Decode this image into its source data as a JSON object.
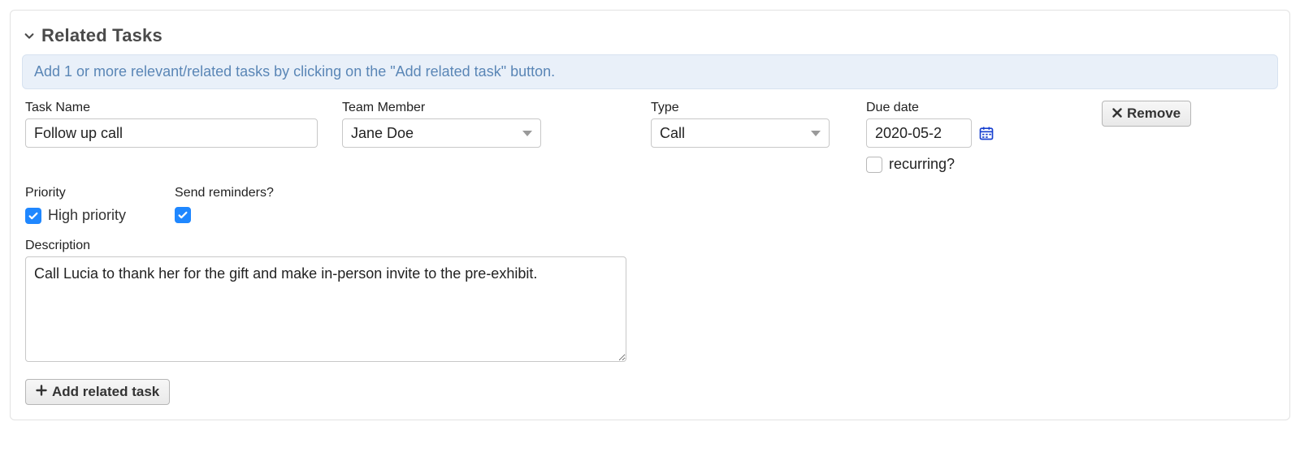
{
  "section": {
    "title": "Related Tasks",
    "expanded": true
  },
  "hint": "Add 1 or more relevant/related tasks by clicking on the \"Add related task\" button.",
  "labels": {
    "task_name": "Task Name",
    "team_member": "Team Member",
    "type": "Type",
    "due_date": "Due date",
    "recurring": "recurring?",
    "priority": "Priority",
    "high_priority": "High priority",
    "send_reminders": "Send reminders?",
    "description": "Description",
    "add_related_task": "Add related task",
    "remove": "Remove"
  },
  "task": {
    "name": "Follow up call",
    "team_member": "Jane Doe",
    "type": "Call",
    "due_date": "2020-05-2",
    "recurring": false,
    "high_priority": true,
    "send_reminders": true,
    "description": "Call Lucia to thank her for the gift and make in-person invite to the pre-exhibit."
  }
}
